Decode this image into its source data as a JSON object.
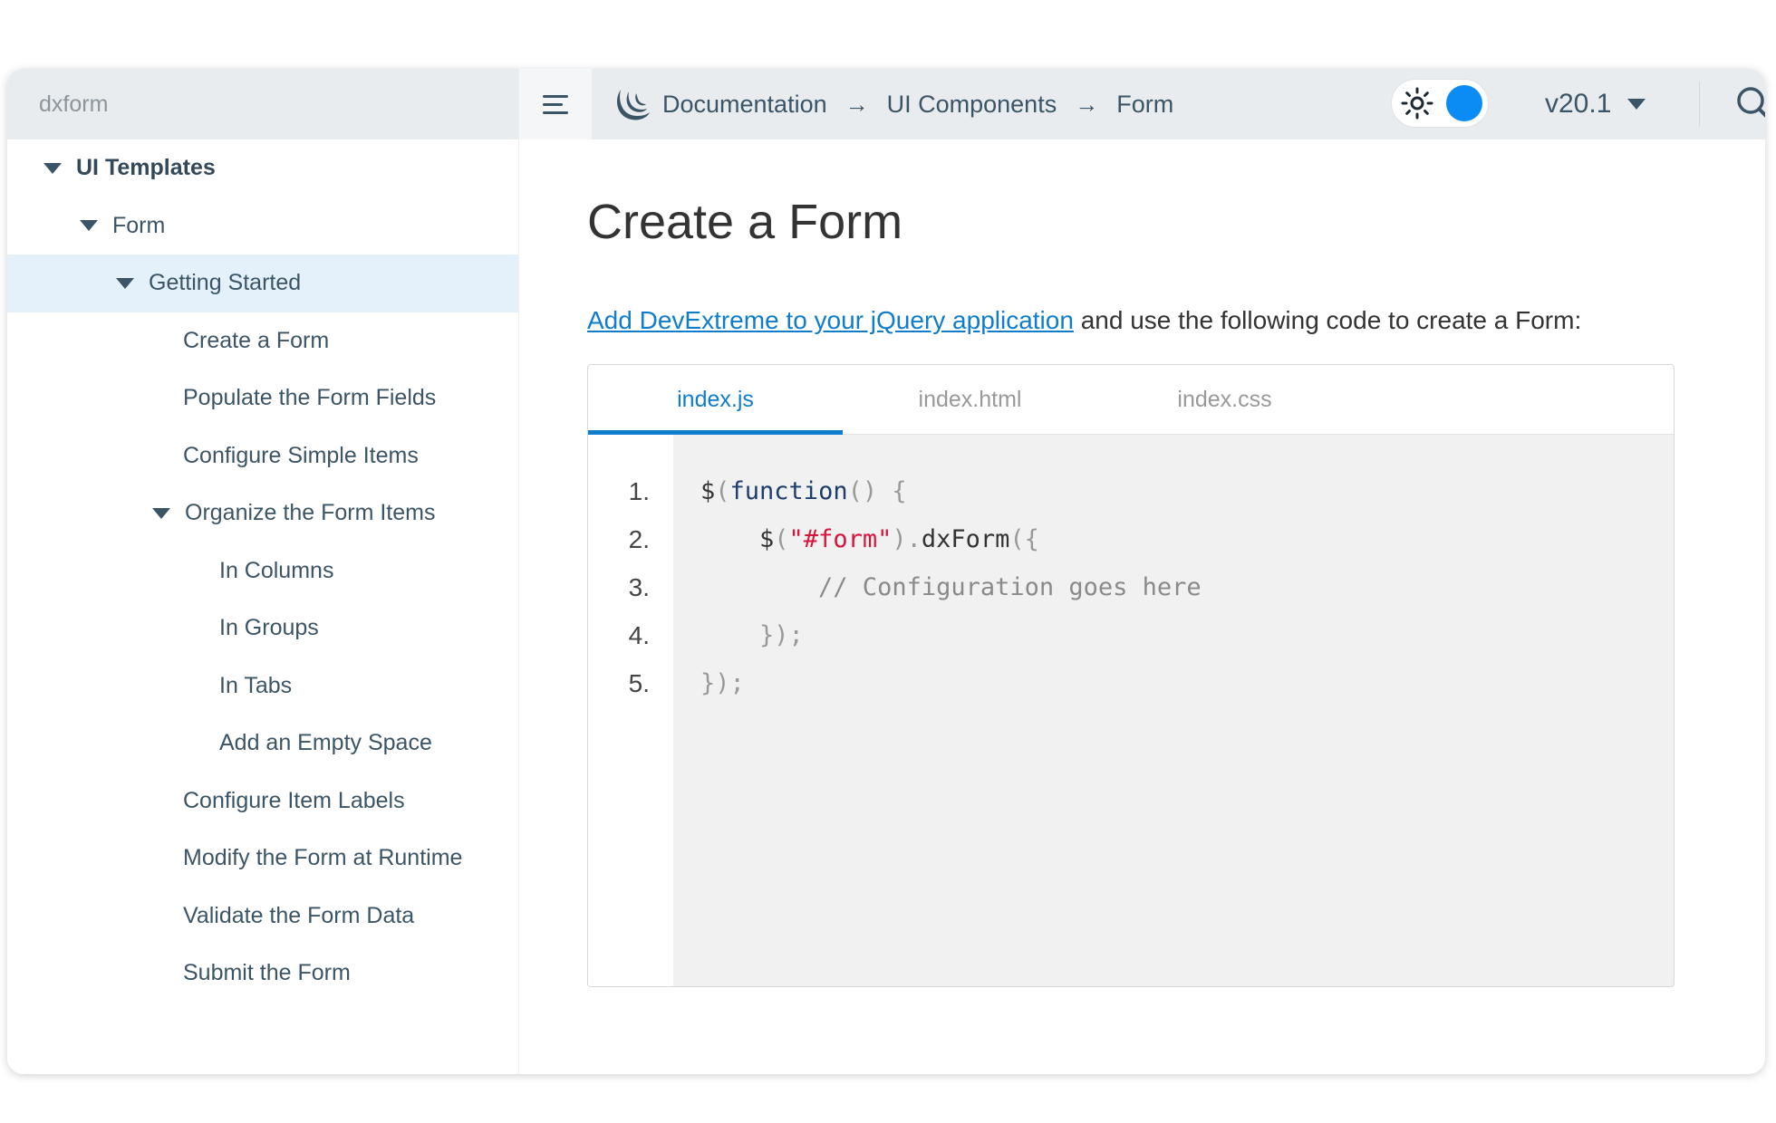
{
  "sidebar": {
    "search_text": "dxform",
    "items": [
      {
        "label": "UI Templates"
      },
      {
        "label": "Form"
      },
      {
        "label": "Getting Started"
      },
      {
        "label": "Create a Form"
      },
      {
        "label": "Populate the Form Fields"
      },
      {
        "label": "Configure Simple Items"
      },
      {
        "label": "Organize the Form Items"
      },
      {
        "label": "In Columns"
      },
      {
        "label": "In Groups"
      },
      {
        "label": "In Tabs"
      },
      {
        "label": "Add an Empty Space"
      },
      {
        "label": "Configure Item Labels"
      },
      {
        "label": "Modify the Form at Runtime"
      },
      {
        "label": "Validate the Form Data"
      },
      {
        "label": "Submit the Form"
      }
    ]
  },
  "header": {
    "breadcrumb": [
      "Documentation",
      "UI Components",
      "Form"
    ],
    "arrow": "→",
    "version": "v20.1",
    "accent_color": "#0b8cf5"
  },
  "main": {
    "title": "Create a Form",
    "intro_link": "Add DevExtreme to your jQuery application",
    "intro_rest": " and use the following code to create a Form:",
    "tabs": [
      "index.js",
      "index.html",
      "index.css"
    ],
    "active_tab": "index.js",
    "line_numbers": [
      "1.",
      "2.",
      "3.",
      "4.",
      "5."
    ],
    "code": {
      "l1_a": "$",
      "l1_b": "(",
      "l1_c": "function",
      "l1_d": "() {",
      "l2_a": "    $",
      "l2_b": "(",
      "l2_c": "\"#form\"",
      "l2_d": ").",
      "l2_e": "dxForm",
      "l2_f": "({",
      "l3": "        // Configuration goes here",
      "l4": "    });",
      "l5": "});"
    }
  }
}
